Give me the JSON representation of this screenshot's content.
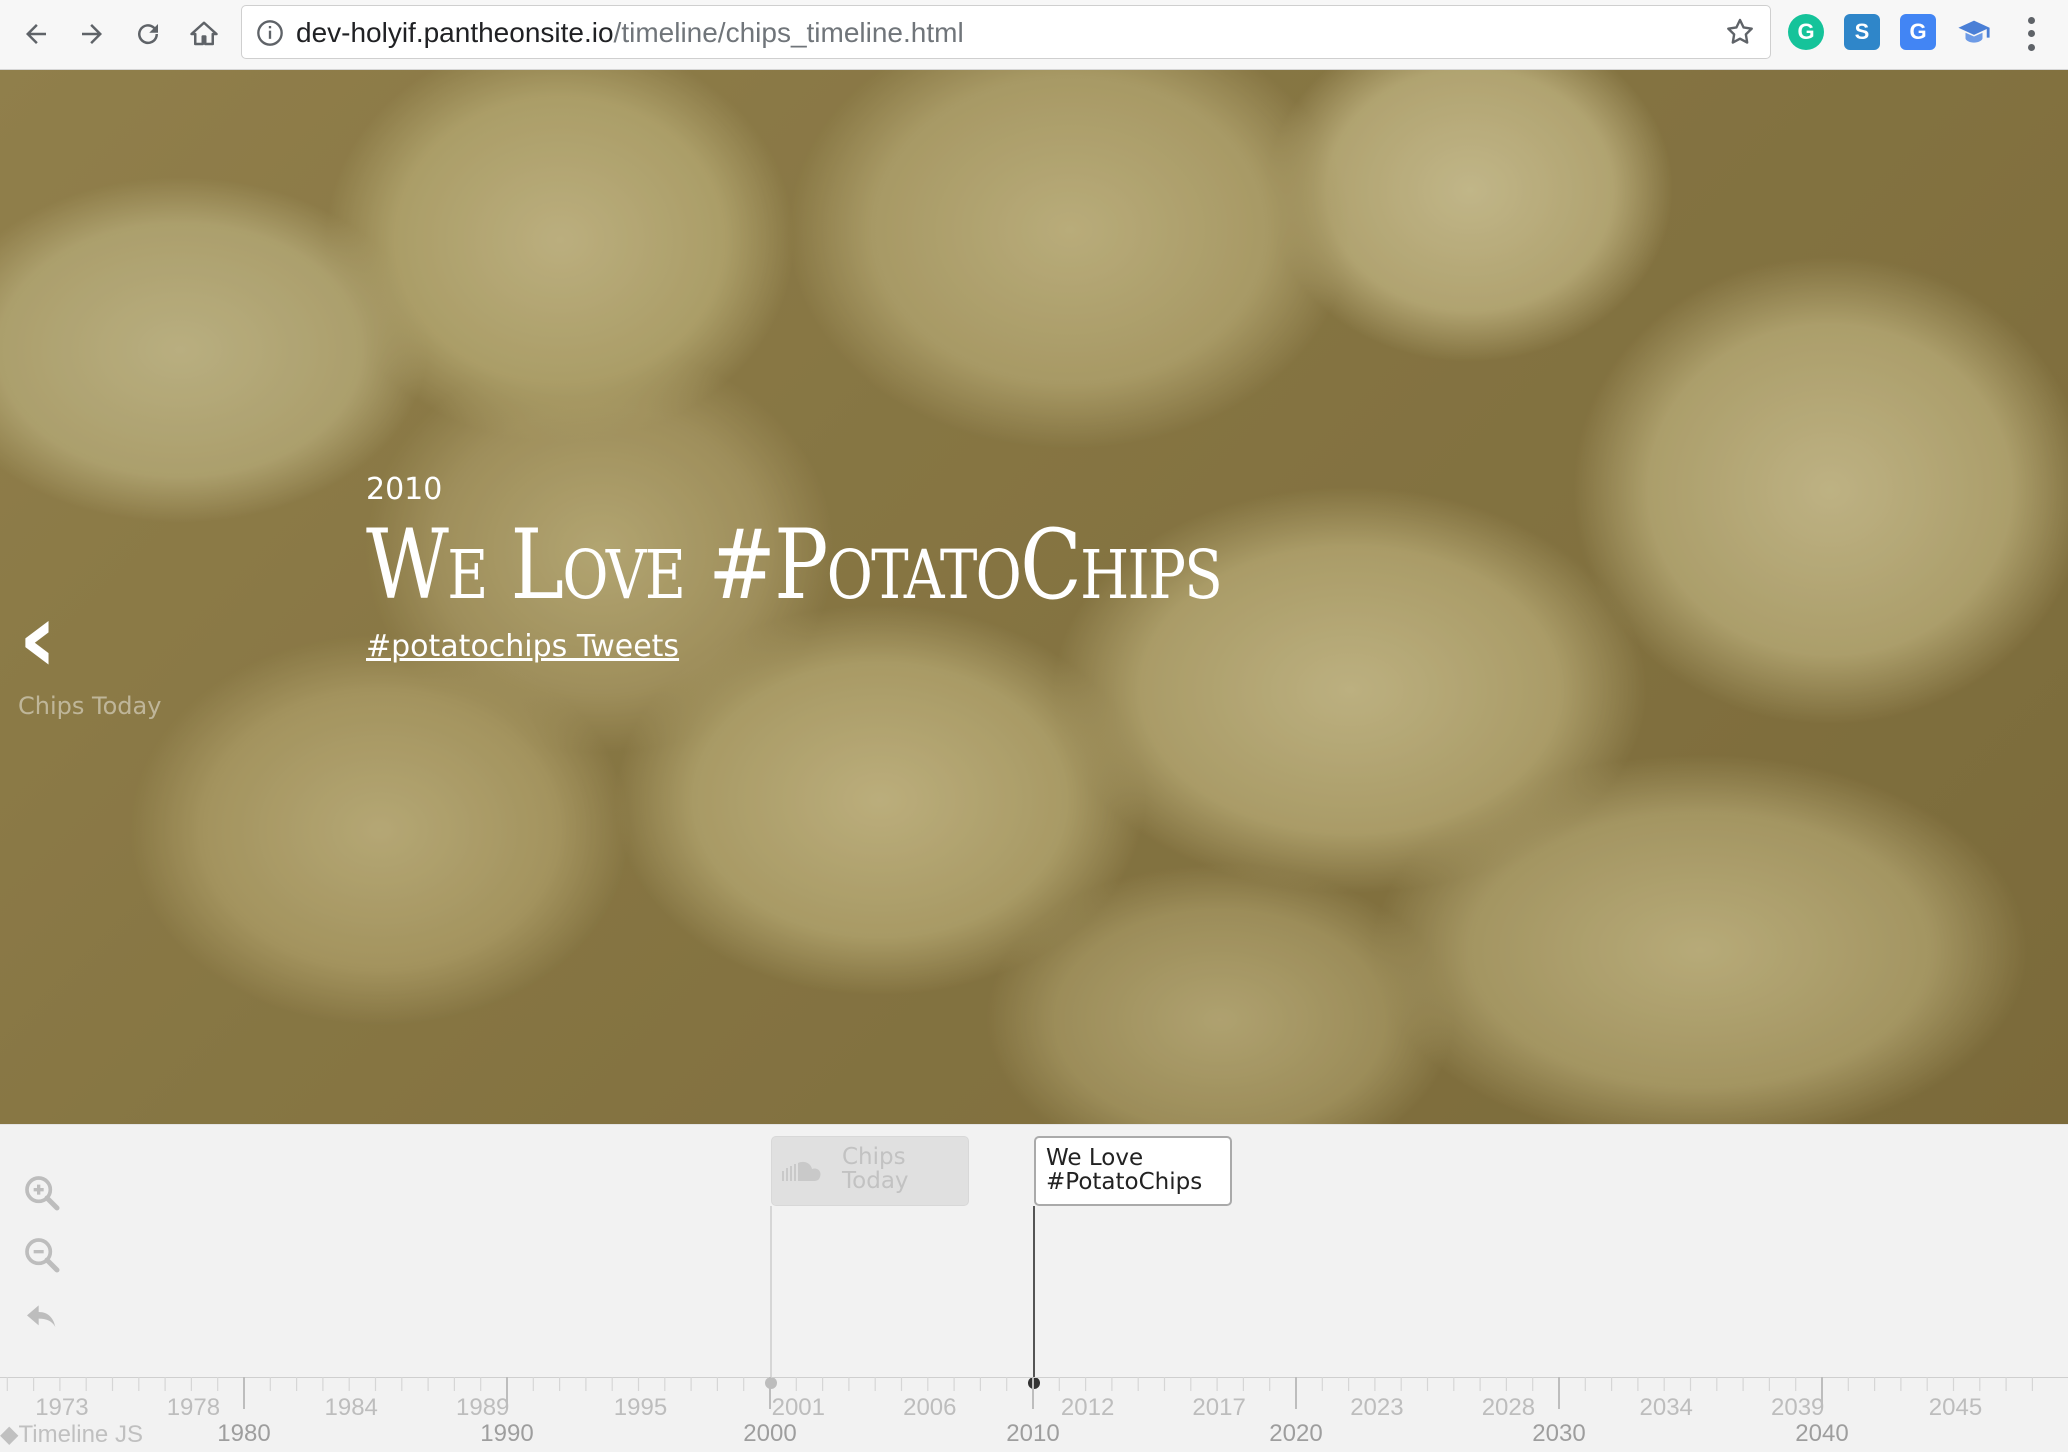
{
  "browser": {
    "url_domain": "dev-holyif.pantheonsite.io",
    "url_path": "/timeline/chips_timeline.html",
    "extensions": [
      {
        "name": "grammarly-icon",
        "label": "G",
        "color": "#15c39a"
      },
      {
        "name": "s-extension-icon",
        "label": "S",
        "color": "#2f86c9"
      },
      {
        "name": "translate-icon",
        "label": "G",
        "color": "#4285f4"
      },
      {
        "name": "graduation-cap-icon",
        "label": "",
        "color": "#4a7fd6"
      }
    ]
  },
  "slide": {
    "date": "2010",
    "headline": "We Love #PotatoChips",
    "link_text": "#potatochips Tweets",
    "prev_title": "Chips Today"
  },
  "timeline": {
    "brand": "Timeline JS",
    "markers": [
      {
        "title": "Chips Today",
        "active": false,
        "year": 2000
      },
      {
        "title": "We Love #PotatoChips",
        "active": true,
        "year": 2010
      }
    ],
    "minor_ticks": [
      "1973",
      "1978",
      "1984",
      "1989",
      "1995",
      "2001",
      "2006",
      "2012",
      "2017",
      "2023",
      "2028",
      "2034",
      "2039",
      "2045"
    ],
    "major_ticks": [
      "1980",
      "1990",
      "2000",
      "2010",
      "2020",
      "2030",
      "2040"
    ]
  }
}
